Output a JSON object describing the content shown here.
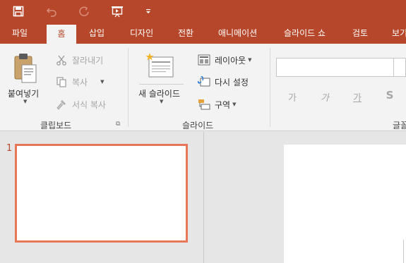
{
  "app": "PowerPoint",
  "colors": {
    "accent": "#b7472a",
    "ribbon_bg": "#f3f3f3",
    "thumb_border": "#e8775a"
  },
  "qat": {
    "icons": [
      "save-icon",
      "undo-icon",
      "redo-icon",
      "start-from-beginning-icon",
      "customize-qat-icon"
    ]
  },
  "tabs": [
    {
      "label": "파일"
    },
    {
      "label": "홈",
      "active": true
    },
    {
      "label": "삽입"
    },
    {
      "label": "디자인"
    },
    {
      "label": "전환"
    },
    {
      "label": "애니메이션"
    },
    {
      "label": "슬라이드 쇼"
    },
    {
      "label": "검토"
    },
    {
      "label": "보기"
    }
  ],
  "ribbon": {
    "clipboard": {
      "paste_label": "붙여넣기",
      "cut_label": "잘라내기",
      "copy_label": "복사",
      "format_painter_label": "서식 복사",
      "group_label": "클립보드"
    },
    "slides": {
      "new_slide_label": "새 슬라이드",
      "layout_label": "레이아웃",
      "reset_label": "다시 설정",
      "section_label": "구역",
      "group_label": "슬라이드"
    },
    "font": {
      "font_name_value": "",
      "bold_label": "가",
      "italic_label": "가",
      "underline_label": "가",
      "shadow_label": "S",
      "group_label": "글꼴"
    }
  },
  "thumbnails": [
    {
      "number": "1"
    }
  ]
}
